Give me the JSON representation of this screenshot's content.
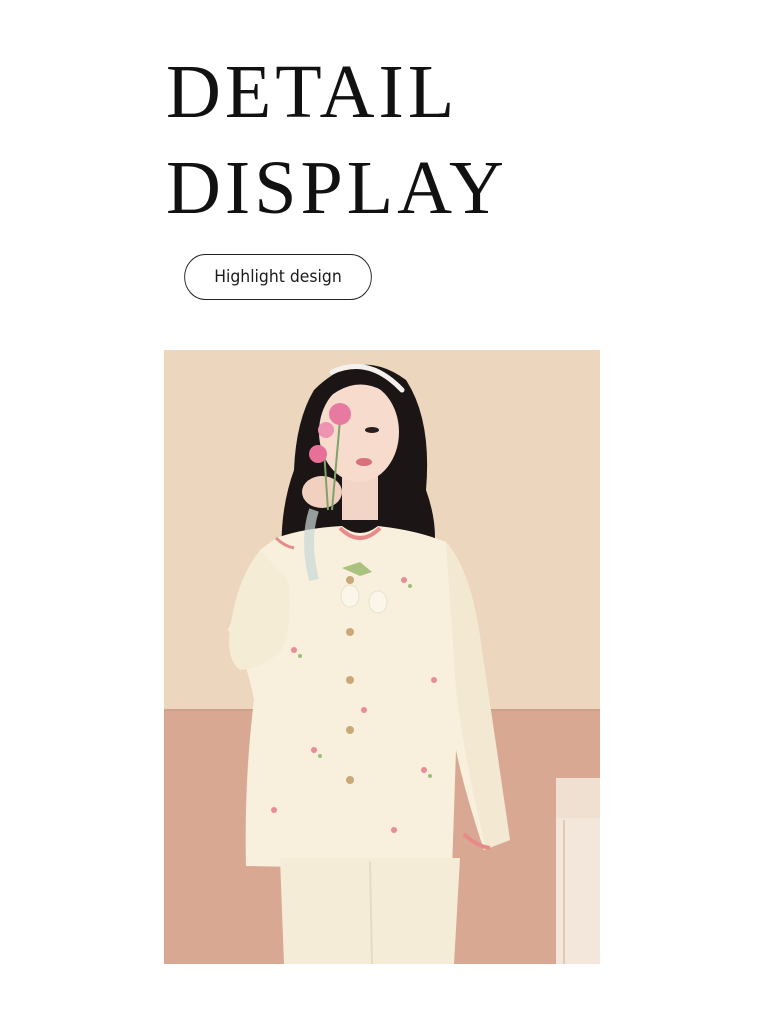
{
  "heading": {
    "line1": "DETAIL",
    "line2": "DISPLAY"
  },
  "badge": {
    "label": "Highlight design"
  },
  "photo": {
    "subject": "model-in-pajamas-photo"
  },
  "colors": {
    "wall_upper": "#ecd6bd",
    "wall_lower": "#d9a892",
    "garment": "#f8f0dc",
    "trim": "#e98a8a",
    "hair": "#1b1515"
  }
}
